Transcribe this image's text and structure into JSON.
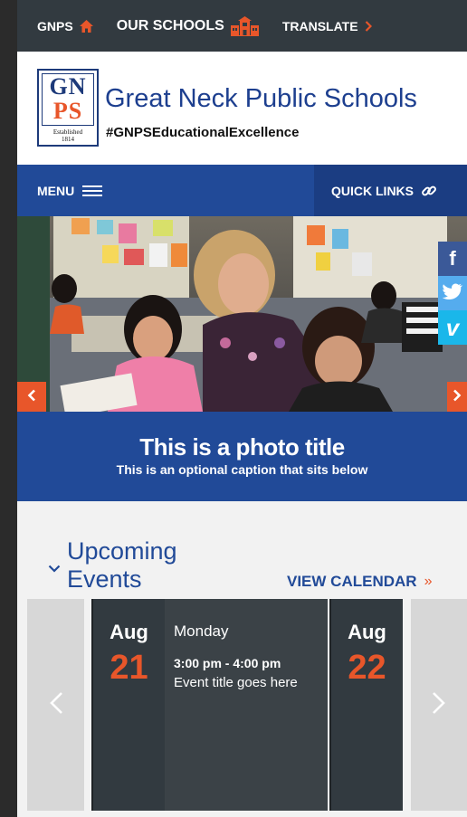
{
  "topbar": {
    "gnps_label": "GNPS",
    "schools_label": "OUR SCHOOLS",
    "translate_label": "TRANSLATE"
  },
  "header": {
    "logo_letters_top": "GN",
    "logo_letters_bottom": "PS",
    "logo_established": "Established",
    "logo_year": "1814",
    "title": "Great Neck Public Schools",
    "hashtag": "#GNPSEducationalExcellence"
  },
  "nav": {
    "menu_label": "MENU",
    "quick_links_label": "QUICK LINKS"
  },
  "social": {
    "facebook": "f",
    "twitter": "twitter-icon",
    "vimeo": "v"
  },
  "hero": {
    "photo_title": "This is a photo title",
    "photo_caption": "This is an optional caption that sits below"
  },
  "events": {
    "heading_line1": "Upcoming",
    "heading_line2": "Events",
    "view_calendar": "VIEW CALENDAR",
    "view_calendar_arrow": "»",
    "items": [
      {
        "month": "Aug",
        "day": "21",
        "weekday": "Monday",
        "time": "3:00 pm - 4:00 pm",
        "title": "Event title goes here"
      },
      {
        "month": "Aug",
        "day": "22"
      }
    ]
  },
  "colors": {
    "accent_orange": "#e8562a",
    "brand_blue": "#214a98",
    "topbar_dark": "#323a40"
  }
}
